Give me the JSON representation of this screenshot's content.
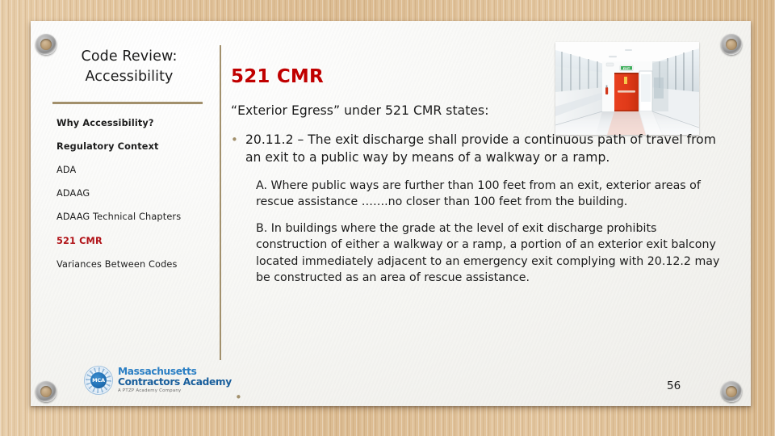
{
  "slide": {
    "deck_title": "Code Review:\nAccessibility",
    "page_number": "56",
    "accent_rule_color": "#a2906c",
    "heading_color": "#c00000",
    "current_item_color": "#b01116"
  },
  "sidebar": {
    "items": [
      {
        "label": "Why Accessibility?",
        "style": "strong",
        "current": false
      },
      {
        "label": "Regulatory Context",
        "style": "strong",
        "current": false
      },
      {
        "label": "ADA",
        "style": "normal",
        "current": false
      },
      {
        "label": "ADAAG",
        "style": "normal",
        "current": false
      },
      {
        "label": "ADAAG Technical Chapters",
        "style": "normal",
        "current": false
      },
      {
        "label": "521 CMR",
        "style": "strong",
        "current": true
      },
      {
        "label": "Variances Between Codes",
        "style": "normal",
        "current": false
      }
    ]
  },
  "logo": {
    "seal_text": "MCA",
    "line1": "Massachusetts",
    "line2": "Contractors Academy",
    "tagline": "A PTZP Academy Company",
    "brand_color": "#2b7fc4"
  },
  "content": {
    "heading": "521 CMR",
    "intro": "“Exterior Egress” under 521 CMR states:",
    "main_bullet": "20.11.2 – The exit discharge shall provide a continuous path of travel from an exit to a public way by means of a walkway or a ramp.",
    "paragraphs": [
      "A.  Where public ways are further than 100 feet from an exit, exterior areas of rescue assistance …….no closer than 100 feet from the building.",
      "B. In buildings where the grade at the level of exit discharge prohibits construction of either a walkway or a ramp, a portion of an exterior exit balcony located immediately adjacent to an emergency exit complying with 20.12.2 may be constructed as an area of rescue assistance."
    ],
    "bullet_glyph": "•"
  },
  "photo": {
    "alt": "corridor-with-red-emergency-exit-door",
    "exit_sign_label": "EXIT"
  }
}
